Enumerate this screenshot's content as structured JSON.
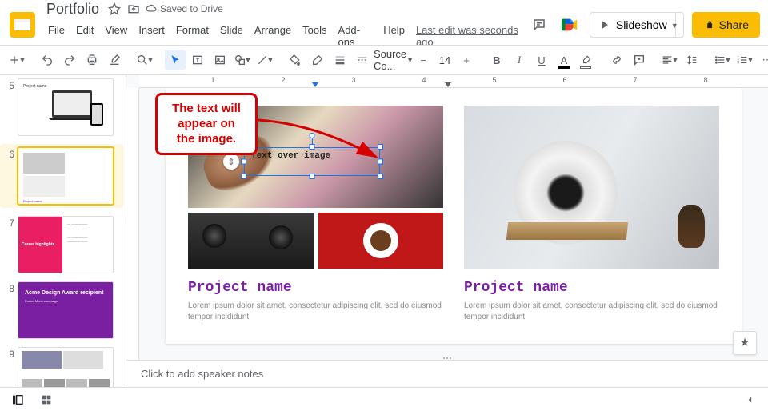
{
  "doc": {
    "title": "Portfolio",
    "save_state": "Saved to Drive",
    "last_edit": "Last edit was seconds ago"
  },
  "menubar": [
    "File",
    "Edit",
    "View",
    "Insert",
    "Format",
    "Slide",
    "Arrange",
    "Tools",
    "Add-ons",
    "Help"
  ],
  "titlebar_buttons": {
    "slideshow": "Slideshow",
    "share": "Share"
  },
  "toolbar": {
    "font_family": "Source Co...",
    "font_size": "14"
  },
  "ruler": {
    "labels": [
      "1",
      "2",
      "3",
      "4",
      "5",
      "6",
      "7",
      "8"
    ]
  },
  "thumbs": [
    {
      "n": "5"
    },
    {
      "n": "6"
    },
    {
      "n": "7",
      "career": "Career highlights"
    },
    {
      "n": "8",
      "award": "Acme Design Award recipient",
      "sub": "Parker Moris campaign"
    },
    {
      "n": "9"
    }
  ],
  "slide": {
    "textbox": "Text over image",
    "project_left": {
      "title": "Project name",
      "desc": "Lorem ipsum dolor sit amet, consectetur adipiscing elit, sed do eiusmod tempor incididunt"
    },
    "project_right": {
      "title": "Project name",
      "desc": "Lorem ipsum dolor sit amet, consectetur adipiscing elit, sed do eiusmod tempor incididunt"
    }
  },
  "annotation": "The text will appear on the image.",
  "notes_placeholder": "Click to add speaker notes"
}
